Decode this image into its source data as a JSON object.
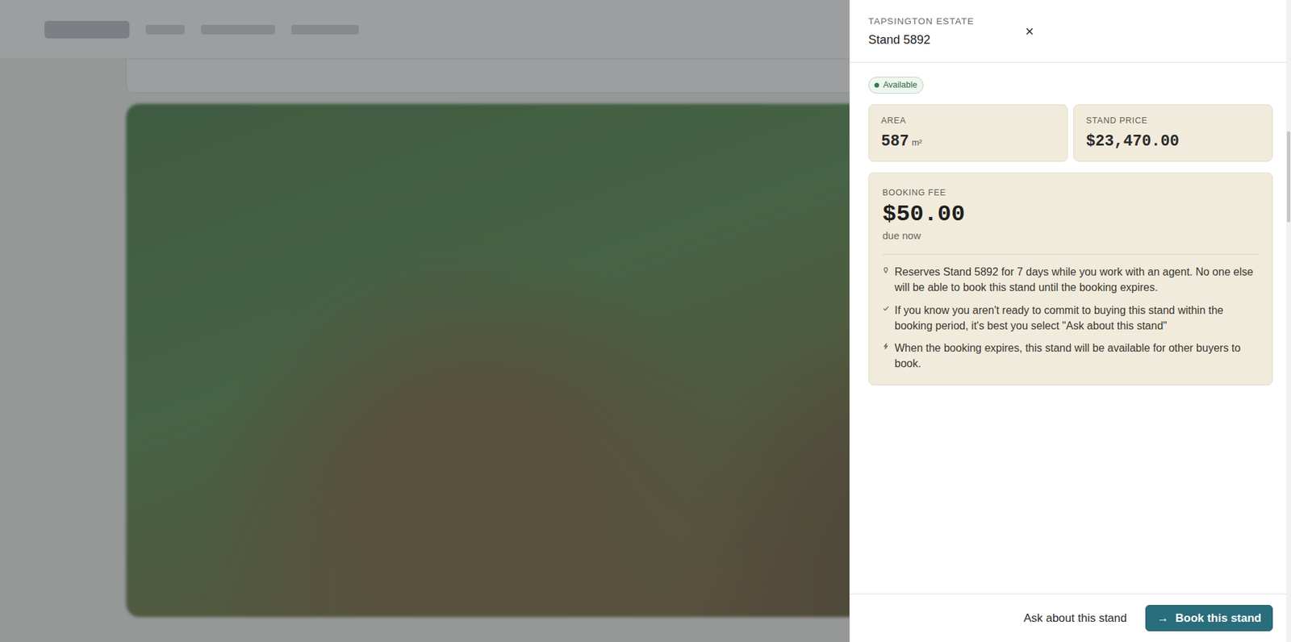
{
  "panel": {
    "estate": "TAPSINGTON ESTATE",
    "title": "Stand 5892",
    "close": "×",
    "status": "Available"
  },
  "stats": [
    {
      "label": "AREA",
      "value": "587",
      "unit": "m²"
    },
    {
      "label": "STAND PRICE",
      "value": "$23,470.00"
    }
  ],
  "booking": {
    "label": "BOOKING FEE",
    "amount": "$50.00",
    "note": "due now",
    "points": [
      {
        "kind": "pin",
        "text": "Reserves Stand 5892 for 7 days while you work with an agent. No one else will be able to book this stand until the booking expires."
      },
      {
        "kind": "check",
        "text": "If you know you aren't ready to commit to buying this stand within the booking period, it's best you select \"Ask about this stand\""
      },
      {
        "kind": "bolt",
        "text": "When the booking expires, this stand will be available for other buyers to book."
      }
    ]
  },
  "actions": [
    {
      "label": "Ask about this stand",
      "kind": "link"
    },
    {
      "label": "Book this stand",
      "kind": "primary",
      "icon": "→"
    }
  ]
}
